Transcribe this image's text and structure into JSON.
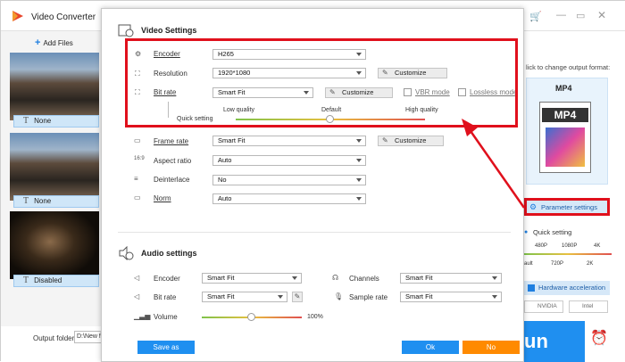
{
  "app": {
    "title": "Video Converter",
    "add_files": "Add Files",
    "output_folder_label": "Output folder:",
    "output_folder_value": "D:\\New fo",
    "run_label": "un"
  },
  "file_list": [
    {
      "subtitle": "None"
    },
    {
      "subtitle": "None"
    },
    {
      "subtitle": "Disabled"
    }
  ],
  "right_panel": {
    "hint": "lick to change output format:",
    "format": "MP4",
    "format_badge": "MP4",
    "parameter_settings": "Parameter settings",
    "quick_setting": "Quick setting",
    "res_top": [
      "480P",
      "1080P",
      "4K"
    ],
    "res_bottom": [
      "ault",
      "720P",
      "2K"
    ],
    "hw_accel": "Hardware acceleration",
    "nvidia": "NVIDIA",
    "intel": "Intel"
  },
  "dialog": {
    "video_title": "Video Settings",
    "audio_title": "Audio settings",
    "video": {
      "encoder_label": "Encoder",
      "encoder_value": "H265",
      "resolution_label": "Resolution",
      "resolution_value": "1920*1080",
      "customize": "Customize",
      "bitrate_label": "Bit rate",
      "bitrate_value": "Smart Fit",
      "vbr_mode": "VBR mode",
      "lossless_mode": "Lossless mode",
      "quick_setting": "Quick setting",
      "low_quality": "Low quality",
      "default": "Default",
      "high_quality": "High quality",
      "quality_level": 0.5,
      "framerate_label": "Frame rate",
      "framerate_value": "Smart Fit",
      "aspect_label": "Aspect ratio",
      "aspect_value": "Auto",
      "deinterlace_label": "Deinterlace",
      "deinterlace_value": "No",
      "norm_label": "Norm",
      "norm_value": "Auto"
    },
    "audio": {
      "encoder_label": "Encoder",
      "encoder_value": "Smart Fit",
      "channels_label": "Channels",
      "channels_value": "Smart Fit",
      "bitrate_label": "Bit rate",
      "bitrate_value": "Smart Fit",
      "samplerate_label": "Sample rate",
      "samplerate_value": "Smart Fit",
      "volume_label": "Volume",
      "volume_value": "100%",
      "volume_level": 0.5
    },
    "save_as": "Save as",
    "ok": "Ok",
    "no": "No"
  },
  "colors": {
    "accent": "#1f8ff0",
    "annotation": "#e0101c",
    "orange": "#ff8a00"
  }
}
